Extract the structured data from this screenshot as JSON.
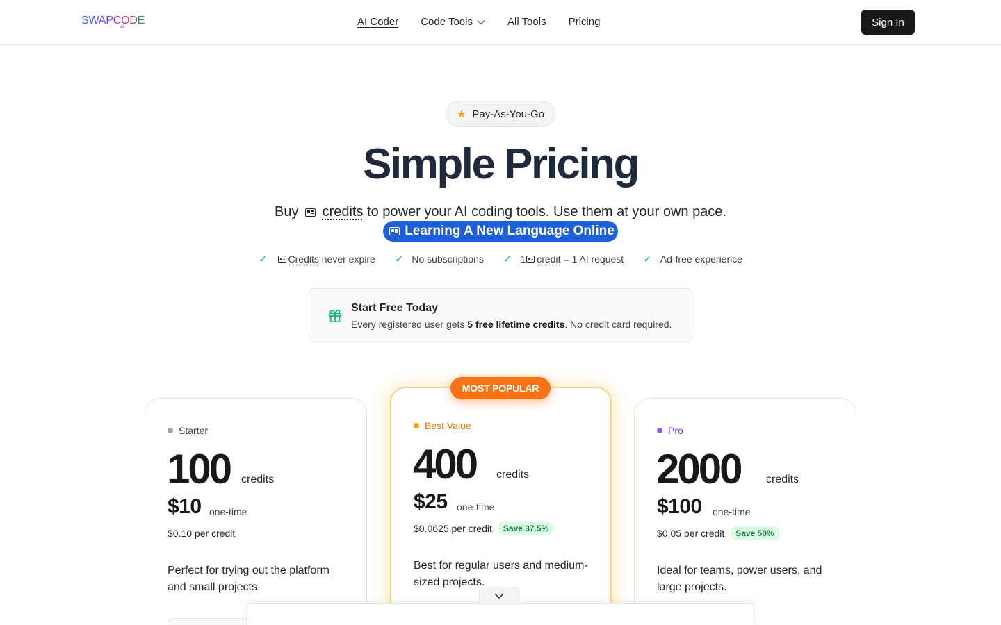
{
  "header": {
    "logo_text": "SWAPCODE",
    "logo_sub": "AI",
    "nav": [
      {
        "label": "AI Coder",
        "active": true
      },
      {
        "label": "Code Tools",
        "has_dropdown": true
      },
      {
        "label": "All Tools"
      },
      {
        "label": "Pricing"
      }
    ],
    "signin_label": "Sign In"
  },
  "hero": {
    "badge": {
      "icon": "star-icon",
      "label": "Pay-As-You-Go"
    },
    "title": "Simple Pricing",
    "subtitle_before": "Buy",
    "subtitle_credits": "credits",
    "subtitle_after": "to power your AI coding tools. Use them at your own pace.",
    "pill_label": "Learning A New Language Online"
  },
  "features": [
    {
      "icon": "check-icon",
      "link": "Credits",
      "text": " never expire"
    },
    {
      "icon": "check-icon",
      "text": "No subscriptions"
    },
    {
      "icon": "check-icon",
      "prefix": "1",
      "link": "credit",
      "text": " = 1 AI request"
    },
    {
      "icon": "check-icon",
      "text": "Ad-free experience"
    }
  ],
  "free_box": {
    "icon": "gift-icon",
    "title": "Start Free Today",
    "sub_before": "Every registered user gets ",
    "sub_bold": "5 free lifetime credits",
    "sub_after": ". No credit card required."
  },
  "plans": [
    {
      "tier": "Starter",
      "tier_color": "#94a3b8",
      "credits": "100",
      "unit": "credits",
      "price": "$10",
      "price_note": "one-time",
      "per_credit": "$0.10 per credit",
      "save": "",
      "description": "Perfect for trying out the platform and small projects."
    },
    {
      "tier": "Best Value",
      "tier_color": "#f59e0b",
      "credits": "400",
      "unit": "credits",
      "price": "$25",
      "price_note": "one-time",
      "per_credit": "$0.0625 per credit",
      "save": "Save 37.5%",
      "description": "Best for regular users and medium-sized projects.",
      "ribbon": "MOST POPULAR"
    },
    {
      "tier": "Pro",
      "tier_color": "#8b5cf6",
      "credits": "2000",
      "unit": "credits",
      "price": "$100",
      "price_note": "one-time",
      "per_credit": "$0.05 per credit",
      "save": "Save 50%",
      "description": "Ideal for teams, power users, and large projects."
    }
  ],
  "colors": {
    "accent_orange": "#f97316",
    "accent_blue": "#1d5fd6",
    "check_green": "#10b981",
    "title": "#1e293b"
  }
}
